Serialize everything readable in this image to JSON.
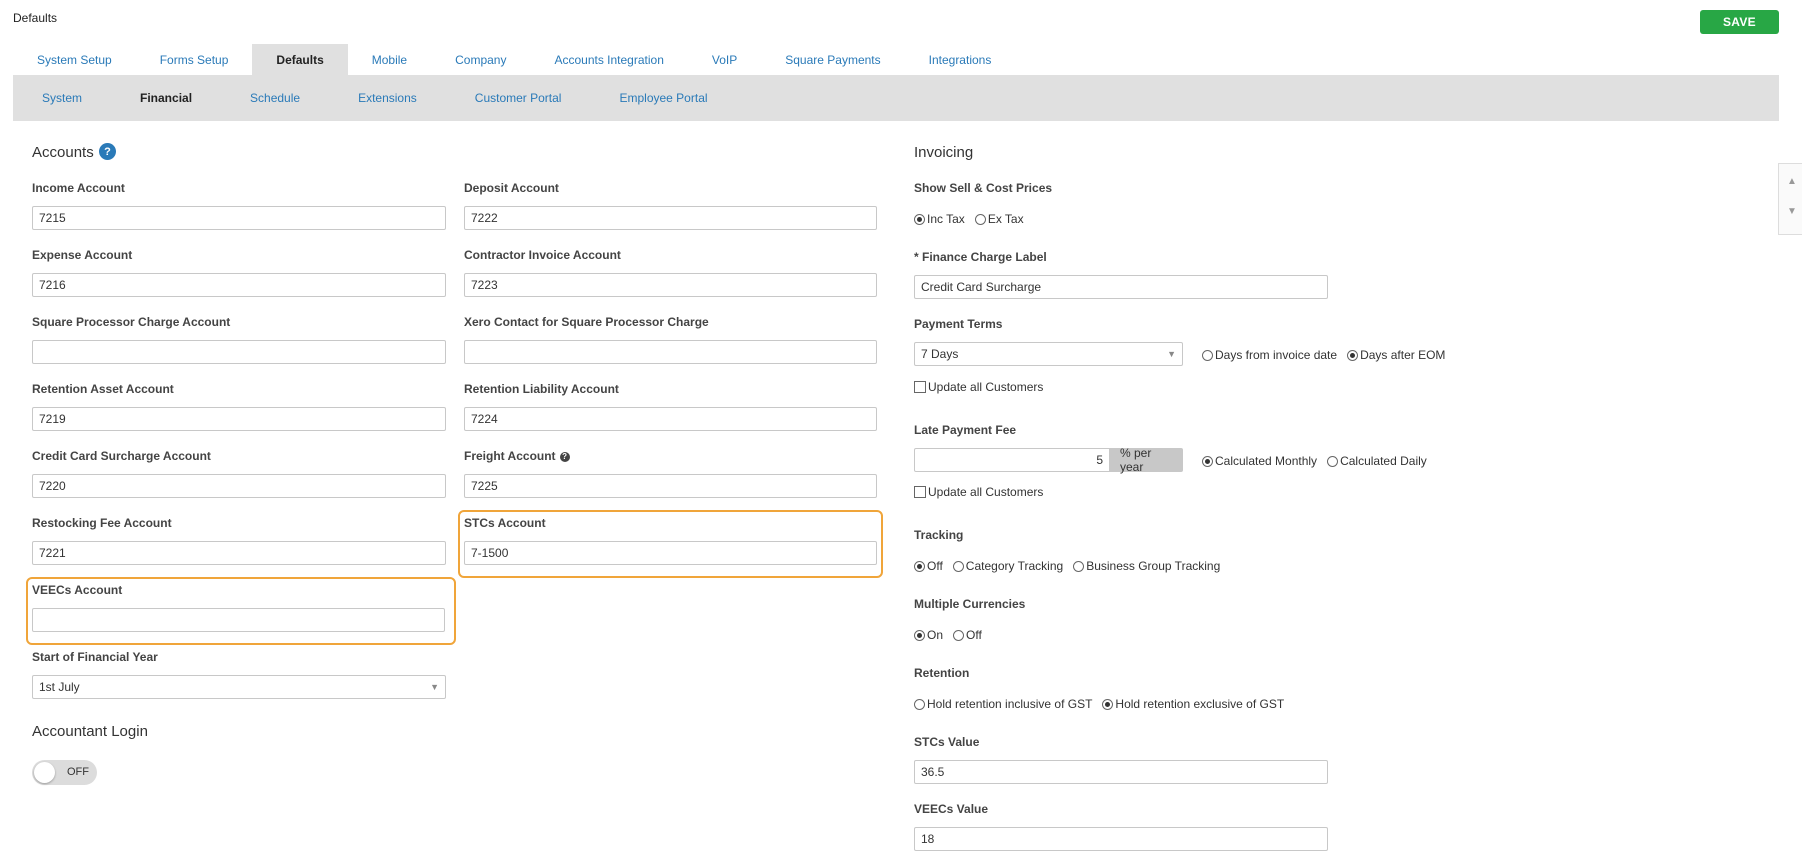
{
  "page": {
    "title": "Defaults",
    "save_label": "SAVE"
  },
  "tabs": [
    "System Setup",
    "Forms Setup",
    "Defaults",
    "Mobile",
    "Company",
    "Accounts Integration",
    "VoIP",
    "Square Payments",
    "Integrations"
  ],
  "active_tab": "Defaults",
  "subtabs": [
    "System",
    "Financial",
    "Schedule",
    "Extensions",
    "Customer Portal",
    "Employee Portal"
  ],
  "active_subtab": "Financial",
  "accounts": {
    "heading": "Accounts",
    "help_glyph": "?",
    "income_label": "Income Account",
    "income_value": "7215",
    "deposit_label": "Deposit Account",
    "deposit_value": "7222",
    "expense_label": "Expense Account",
    "expense_value": "7216",
    "contractor_label": "Contractor Invoice Account",
    "contractor_value": "7223",
    "square_label": "Square Processor Charge Account",
    "square_value": "",
    "xero_label": "Xero Contact for Square Processor Charge",
    "xero_value": "",
    "ret_asset_label": "Retention Asset Account",
    "ret_asset_value": "7219",
    "ret_liab_label": "Retention Liability Account",
    "ret_liab_value": "7224",
    "cc_label": "Credit Card Surcharge Account",
    "cc_value": "7220",
    "freight_label": "Freight Account",
    "freight_value": "7225",
    "restock_label": "Restocking Fee Account",
    "restock_value": "7221",
    "stcs_label": "STCs Account",
    "stcs_value": "7-1500",
    "veecs_label": "VEECs Account",
    "veecs_value": "",
    "fy_label": "Start of Financial Year",
    "fy_value": "1st July"
  },
  "accountant": {
    "heading": "Accountant Login",
    "toggle_state": "OFF"
  },
  "invoicing": {
    "heading": "Invoicing",
    "prices_label": "Show Sell & Cost Prices",
    "prices_options": [
      "Inc Tax",
      "Ex Tax"
    ],
    "prices_selected": "Inc Tax",
    "finance_label": "* Finance Charge Label",
    "finance_value": "Credit Card Surcharge",
    "terms_label": "Payment Terms",
    "terms_value": "7 Days",
    "terms_options": [
      "Days from invoice date",
      "Days after EOM"
    ],
    "terms_selected": "Days after EOM",
    "update_all_label": "Update all Customers",
    "late_label": "Late Payment Fee",
    "late_value": "5",
    "late_unit": "% per year",
    "late_options": [
      "Calculated Monthly",
      "Calculated Daily"
    ],
    "late_selected": "Calculated Monthly",
    "tracking_label": "Tracking",
    "tracking_options": [
      "Off",
      "Category Tracking",
      "Business Group Tracking"
    ],
    "tracking_selected": "Off",
    "currency_label": "Multiple Currencies",
    "currency_options": [
      "On",
      "Off"
    ],
    "currency_selected": "On",
    "retention_label": "Retention",
    "retention_options": [
      "Hold retention inclusive of GST",
      "Hold retention exclusive of GST"
    ],
    "retention_selected": "Hold retention exclusive of GST",
    "stcs_value_label": "STCs Value",
    "stcs_value": "36.5",
    "veecs_value_label": "VEECs Value",
    "veecs_value": "18"
  },
  "colors": {
    "link": "#2a7ab8",
    "save": "#28a745",
    "highlight": "#f0a53a",
    "nav_bg": "#e0e0e0"
  },
  "icons": {
    "scroll_up": "▲",
    "scroll_down": "▼",
    "caret": "▼"
  }
}
